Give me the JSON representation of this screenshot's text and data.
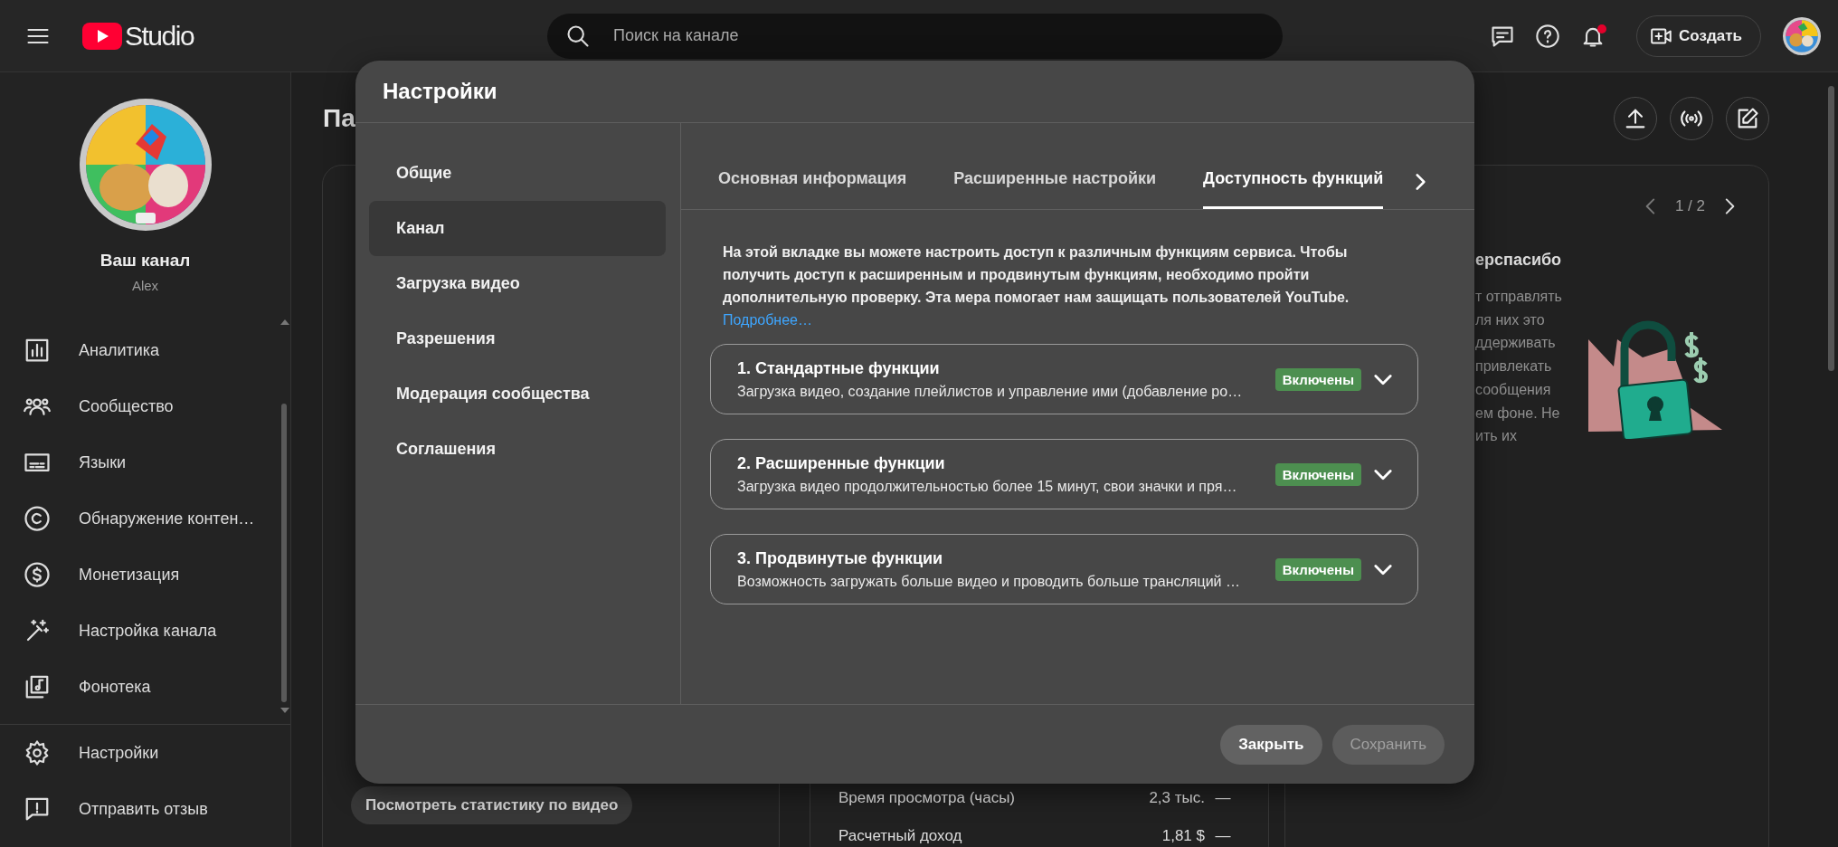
{
  "topbar": {
    "logo_text": "Studio",
    "search": {
      "placeholder": "Поиск на канале"
    },
    "notifications_unread": true,
    "create_button": "Создать"
  },
  "sidebar": {
    "channel_name": "Ваш канал",
    "channel_handle": "Alex",
    "items": [
      {
        "label": "Аналитика"
      },
      {
        "label": "Сообщество"
      },
      {
        "label": "Языки"
      },
      {
        "label": "Обнаружение контен…"
      },
      {
        "label": "Монетизация"
      },
      {
        "label": "Настройка канала"
      },
      {
        "label": "Фонотека"
      }
    ],
    "bottom_items": [
      {
        "label": "Настройки"
      },
      {
        "label": "Отправить отзыв"
      }
    ]
  },
  "main": {
    "heading": "Па",
    "video_stats_button": "Посмотреть статистику по видео",
    "stats": [
      {
        "label": "Время просмотра (часы)",
        "value": "2,3 тыс.",
        "change": "—"
      },
      {
        "label": "Расчетный доход",
        "value": "1,81 $",
        "change": "—"
      }
    ],
    "promo_card": {
      "pager": "1 / 2",
      "title": "ерспасибо",
      "lines": [
        "т отправлять",
        "ля них это",
        "ддерживать",
        "привлекать",
        "сообщения",
        "ем фоне. Не",
        "ить их"
      ]
    }
  },
  "dialog": {
    "title": "Настройки",
    "nav": [
      {
        "label": "Общие",
        "selected": false
      },
      {
        "label": "Канал",
        "selected": true
      },
      {
        "label": "Загрузка видео",
        "selected": false
      },
      {
        "label": "Разрешения",
        "selected": false
      },
      {
        "label": "Модерация сообщества",
        "selected": false
      },
      {
        "label": "Соглашения",
        "selected": false
      }
    ],
    "tabs": [
      {
        "label": "Основная информация",
        "selected": false
      },
      {
        "label": "Расширенные настройки",
        "selected": false
      },
      {
        "label": "Доступность функций",
        "selected": true
      }
    ],
    "intro": "На этой вкладке вы можете настроить доступ к различным функциям сервиса. Чтобы получить доступ к расширенным и продвинутым функциям, необходимо пройти дополнительную проверку. Эта мера помогает нам защищать пользователей YouTube.",
    "intro_link": "Подробнее…",
    "features": [
      {
        "title": "1. Стандартные функции",
        "description": "Загрузка видео, создание плейлистов и управление ими (добавление ро…",
        "status": "Включены",
        "expanded": false
      },
      {
        "title": "2. Расширенные функции",
        "description": "Загрузка видео продолжительностью более 15 минут, свои значки и пря…",
        "status": "Включены",
        "expanded": false
      },
      {
        "title": "3. Продвинутые функции",
        "description": "Возможность загружать больше видео и проводить больше трансляций …",
        "status": "Включены",
        "expanded": false
      }
    ],
    "buttons": [
      {
        "label": "Закрыть",
        "kind": "primary"
      },
      {
        "label": "Сохранить",
        "kind": "disabled"
      }
    ]
  }
}
